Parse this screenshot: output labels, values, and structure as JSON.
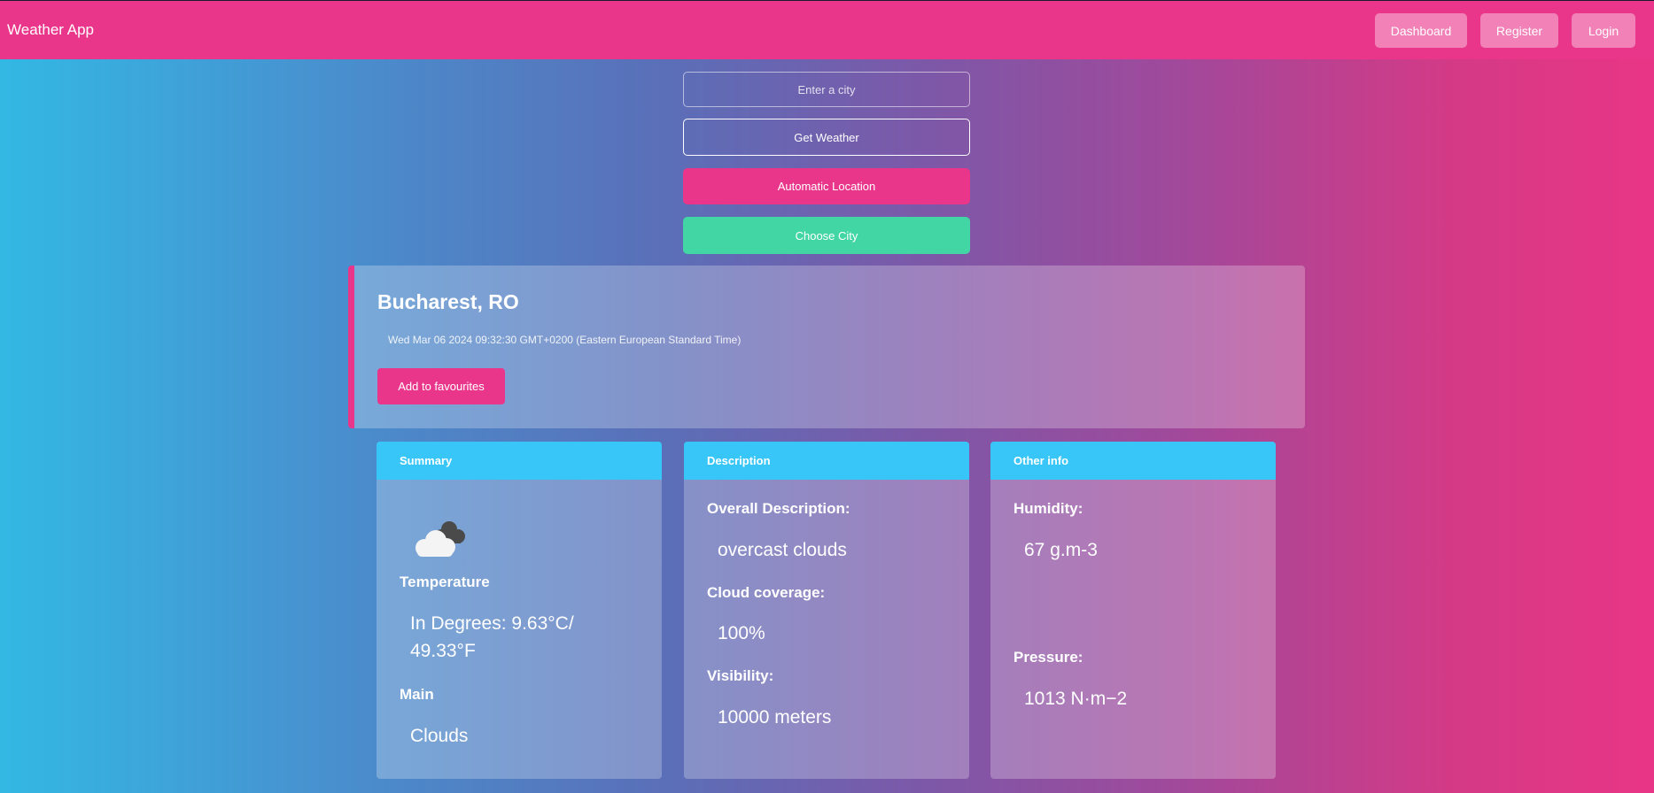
{
  "app": {
    "brand": "Weather App",
    "nav": {
      "dashboard": "Dashboard",
      "register": "Register",
      "login": "Login"
    }
  },
  "controls": {
    "city_placeholder": "Enter a city",
    "get_weather": "Get Weather",
    "auto_location": "Automatic Location",
    "choose_city": "Choose City"
  },
  "location": {
    "title": "Bucharest, RO",
    "datetime": "Wed Mar 06 2024 09:32:30 GMT+0200 (Eastern European Standard Time)",
    "favourite_button": "Add to favourites"
  },
  "summary": {
    "header": "Summary",
    "weather_icon": "cloud-icon",
    "temperature_label": "Temperature",
    "temperature_value": "In Degrees: 9.63°C/ 49.33°F",
    "main_label": "Main",
    "main_value": "Clouds"
  },
  "description": {
    "header": "Description",
    "overall_label": "Overall Description:",
    "overall_value": "overcast clouds",
    "cloud_label": "Cloud coverage:",
    "cloud_value": "100%",
    "visibility_label": "Visibility:",
    "visibility_value": "10000 meters"
  },
  "other": {
    "header": "Other info",
    "humidity_label": "Humidity:",
    "humidity_value": "67 g.m-3",
    "pressure_label": "Pressure:",
    "pressure_value": "1013 N·m−2"
  },
  "colors": {
    "accent_pink": "#e9358a",
    "accent_green": "#42d6a4",
    "card_header_blue": "#38c6f8"
  }
}
